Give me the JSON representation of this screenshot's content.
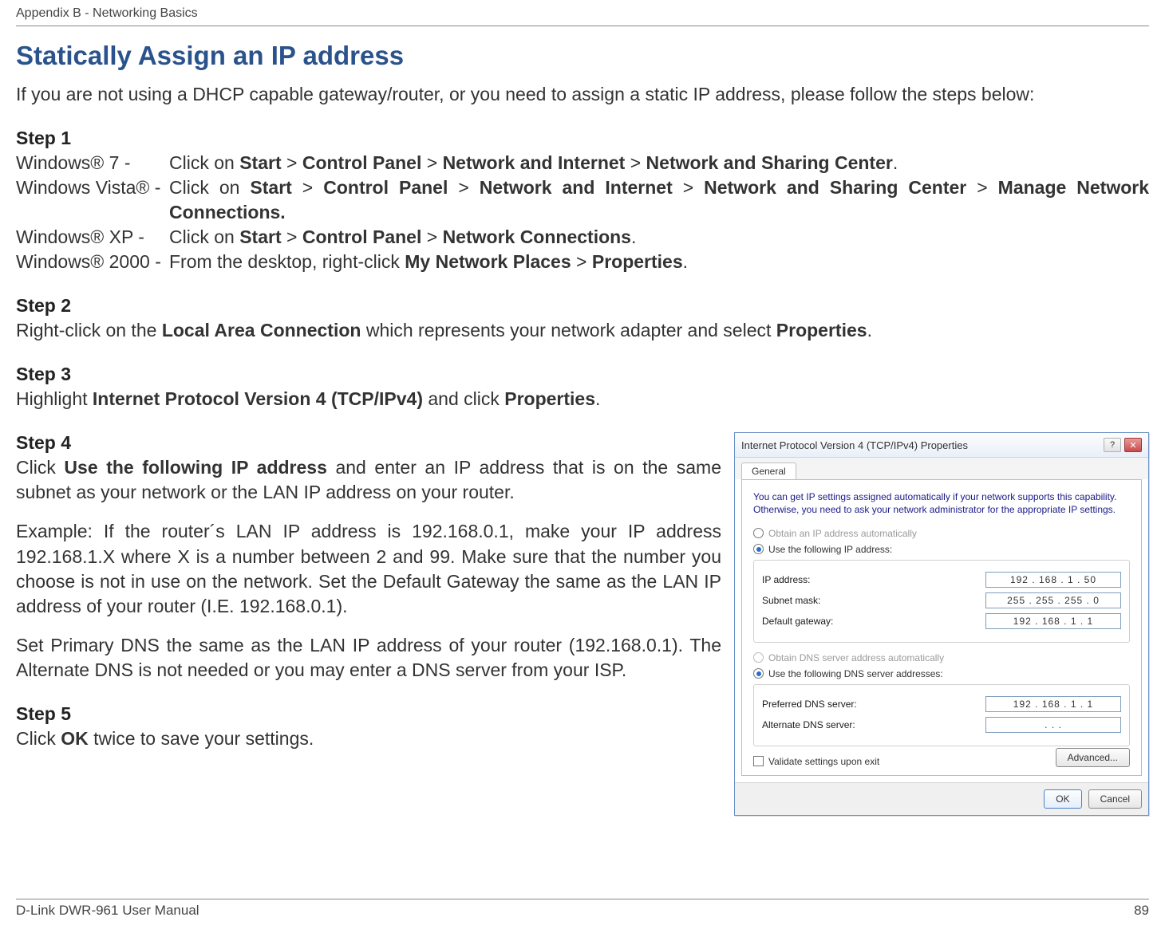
{
  "header": "Appendix B - Networking Basics",
  "title": "Statically Assign an IP address",
  "intro": "If you are not using a DHCP capable gateway/router, or you need to assign a static IP address, please follow the steps below:",
  "step1": {
    "label": "Step 1",
    "rows": [
      {
        "os": "Windows® 7 -",
        "text": "Click on <b>Start</b> > <b>Control Panel</b> > <b>Network and Internet</b> > <b>Network and Sharing Center</b>."
      },
      {
        "os": "Windows Vista® -",
        "text": "Click on <b>Start</b> > <b>Control Panel</b> > <b>Network and Internet</b> > <b>Network and Sharing Center</b> > <b>Manage Network Connections.</b>"
      },
      {
        "os": "Windows® XP -",
        "text": "Click on <b>Start</b> > <b>Control Panel</b> > <b>Network Connections</b>."
      },
      {
        "os": "Windows® 2000 -",
        "text": "From the desktop, right-click <b>My Network Places</b> > <b>Properties</b>."
      }
    ]
  },
  "step2": {
    "label": "Step 2",
    "text": "Right-click on the <b>Local Area Connection</b> which represents your network adapter and select <b>Properties</b>."
  },
  "step3": {
    "label": "Step 3",
    "text": "Highlight <b>Internet Protocol Version 4 (TCP/IPv4)</b> and click <b>Properties</b>."
  },
  "step4": {
    "label": "Step 4",
    "p1": "Click <b>Use the following IP address</b> and enter an IP address that is on the same subnet as your network or the LAN IP address on your router.",
    "p2": "Example: If the router´s LAN IP address is 192.168.0.1, make your IP address 192.168.1.X where X is a number between 2 and 99. Make sure that the number you choose is not in use on the network. Set the Default Gateway the same as the LAN IP address of your router (I.E. 192.168.0.1).",
    "p3": "Set Primary DNS the same as the LAN IP address of your router (192.168.0.1). The Alternate DNS is not needed or you may enter a DNS server from your ISP."
  },
  "step5": {
    "label": "Step 5",
    "text": "Click <b>OK</b> twice to save your settings."
  },
  "dialog": {
    "title": "Internet Protocol Version 4 (TCP/IPv4) Properties",
    "tab": "General",
    "desc": "You can get IP settings assigned automatically if your network supports this capability. Otherwise, you need to ask your network administrator for the appropriate IP settings.",
    "radio_auto_ip": "Obtain an IP address automatically",
    "radio_use_ip": "Use the following IP address:",
    "ip_label": "IP address:",
    "ip_value": "192 . 168 .   1   .  50",
    "mask_label": "Subnet mask:",
    "mask_value": "255 . 255 . 255 .   0",
    "gw_label": "Default gateway:",
    "gw_value": "192 . 168 .   1   .   1",
    "radio_auto_dns": "Obtain DNS server address automatically",
    "radio_use_dns": "Use the following DNS server addresses:",
    "pdns_label": "Preferred DNS server:",
    "pdns_value": "192 . 168 .   1   .   1",
    "adns_label": "Alternate DNS server:",
    "adns_value": ".        .        .",
    "validate": "Validate settings upon exit",
    "advanced": "Advanced...",
    "ok": "OK",
    "cancel": "Cancel"
  },
  "footer": {
    "left": "D-Link DWR-961 User Manual",
    "right": "89"
  }
}
